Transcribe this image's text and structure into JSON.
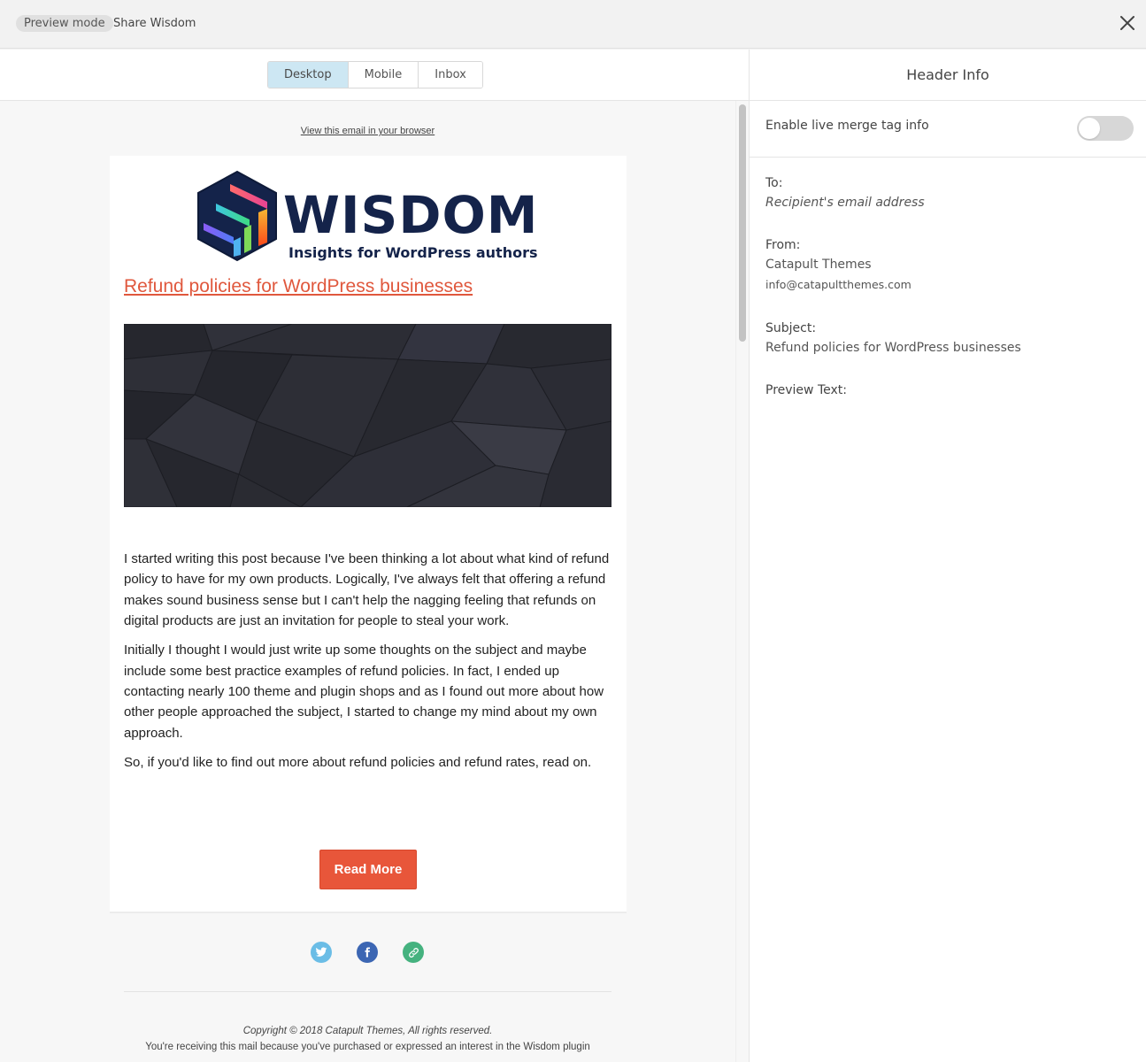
{
  "topbar": {
    "mode_badge": "Preview mode",
    "title": "Share Wisdom",
    "close_icon": "close-icon"
  },
  "preview": {
    "tabs": [
      {
        "label": "Desktop",
        "active": true
      },
      {
        "label": "Mobile",
        "active": false
      },
      {
        "label": "Inbox",
        "active": false
      }
    ],
    "view_in_browser": "View this email in your browser",
    "email": {
      "logo": {
        "wordmark": "WISDOM",
        "tagline": "Insights for WordPress authors",
        "icon": "wisdom-hexagon-logo-icon"
      },
      "headline": "Refund policies for WordPress businesses",
      "hero_image": "dark-polygon-pattern-image",
      "paragraphs": [
        "I started writing this post because I've been thinking a lot about what kind of refund policy to have for my own products. Logically, I've always felt that offering a refund makes sound business sense but I can't help the nagging feeling that refunds on digital products are just an invitation for people to steal your work.",
        "Initially I thought I would just write up some thoughts on the subject and maybe include some best practice examples of refund policies. In fact, I ended up contacting nearly 100 theme and plugin shops and as I found out more about how other people approached the subject, I started to change my mind about my own approach.",
        "So, if you'd like to find out more about refund policies and refund rates, read on."
      ],
      "cta_label": "Read More"
    },
    "social": [
      {
        "icon": "twitter-icon",
        "color": "#6bbde6"
      },
      {
        "icon": "facebook-icon",
        "color": "#3c66b3"
      },
      {
        "icon": "link-icon",
        "color": "#45b27f"
      }
    ],
    "footer": {
      "copyright": "Copyright © 2018 Catapult Themes, All rights reserved.",
      "reason": "You're receiving this mail because you've purchased or expressed an interest in the Wisdom plugin"
    }
  },
  "header_info": {
    "title": "Header Info",
    "merge_toggle_label": "Enable live merge tag info",
    "merge_toggle_on": false,
    "to_label": "To:",
    "to_value": "Recipient's email address",
    "from_label": "From:",
    "from_name": "Catapult Themes",
    "from_email": "info@catapultthemes.com",
    "subject_label": "Subject:",
    "subject_value": "Refund policies for WordPress businesses",
    "preview_text_label": "Preview Text:"
  },
  "colors": {
    "accent": "#e8563a",
    "active_tab": "#cde7f3",
    "brand_navy": "#14234a"
  }
}
